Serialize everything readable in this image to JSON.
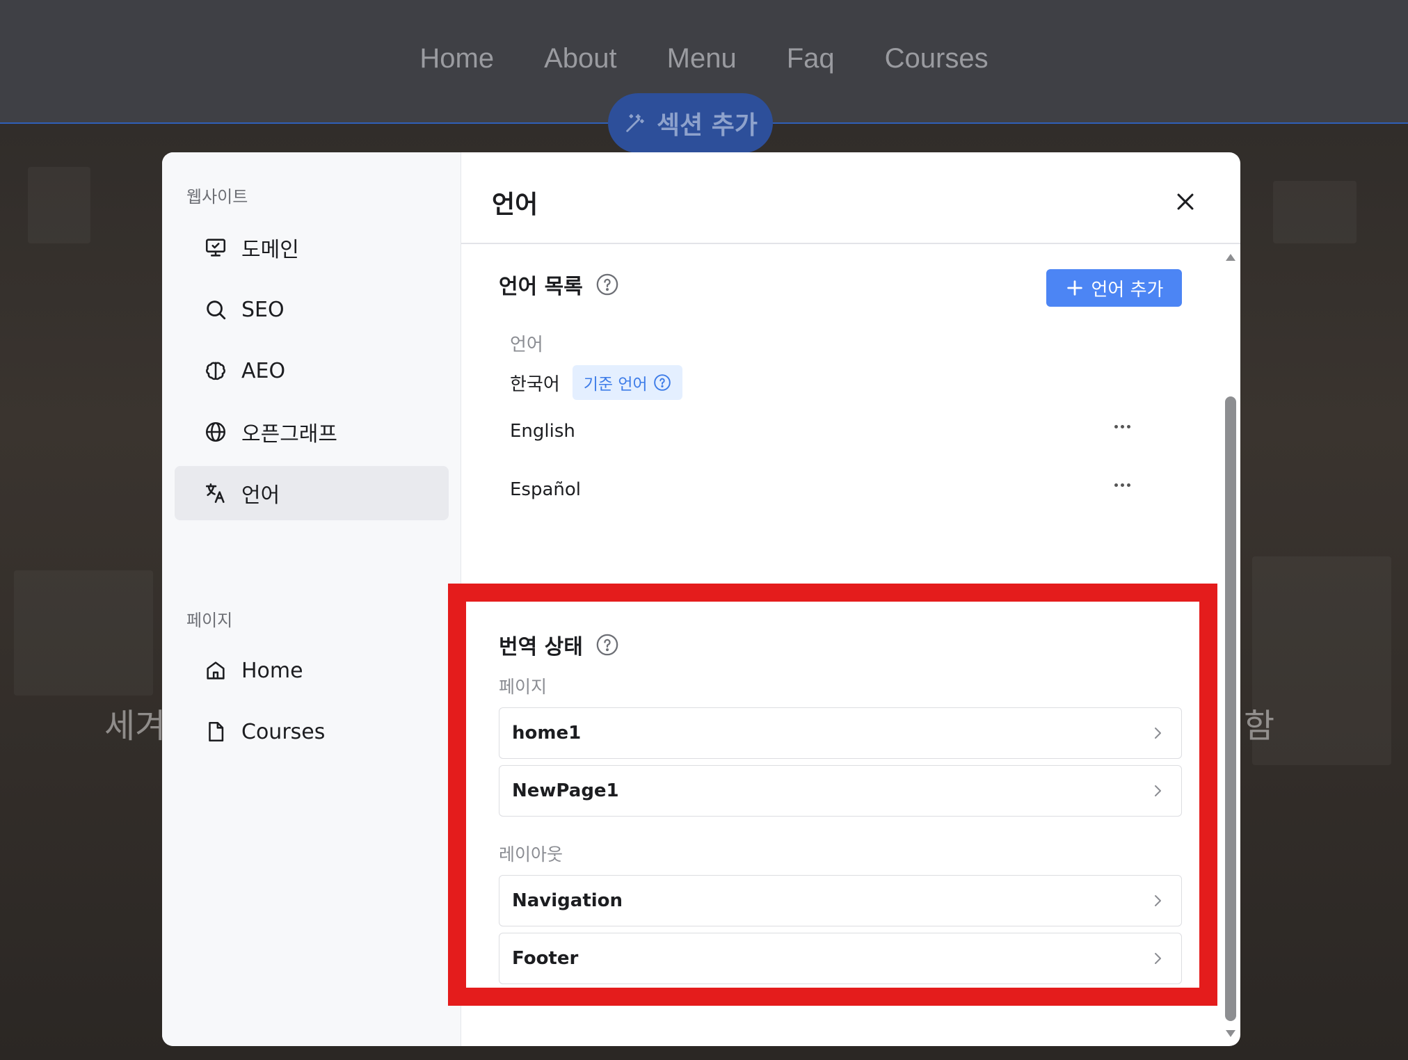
{
  "topnav": {
    "links": [
      "Home",
      "About",
      "Menu",
      "Faq",
      "Courses"
    ],
    "add_section_label": "섹션 추가"
  },
  "background": {
    "left_text": "세겨",
    "right_text": "함"
  },
  "sidebar": {
    "website_group_title": "웹사이트",
    "website_items": [
      {
        "label": "도메인",
        "icon": "monitor-check-icon"
      },
      {
        "label": "SEO",
        "icon": "search-icon"
      },
      {
        "label": "AEO",
        "icon": "brain-icon"
      },
      {
        "label": "오픈그래프",
        "icon": "globe-icon"
      },
      {
        "label": "언어",
        "icon": "translate-icon",
        "active": true
      }
    ],
    "page_group_title": "페이지",
    "page_items": [
      {
        "label": "Home",
        "icon": "home-icon"
      },
      {
        "label": "Courses",
        "icon": "file-icon"
      }
    ]
  },
  "main": {
    "title": "언어",
    "language_list": {
      "title": "언어 목록",
      "add_button": "언어 추가",
      "column_header": "언어",
      "languages": [
        {
          "name": "한국어",
          "badge": "기준 언어"
        },
        {
          "name": "English"
        },
        {
          "name": "Español"
        }
      ]
    },
    "translation_status": {
      "title": "번역 상태",
      "pages_label": "페이지",
      "pages": [
        "home1",
        "NewPage1"
      ],
      "layouts_label": "레이아웃",
      "layouts": [
        "Navigation",
        "Footer"
      ]
    }
  },
  "colors": {
    "accent": "#4c85f4",
    "highlight": "#e41c1c",
    "badge_bg": "#e4efff"
  }
}
